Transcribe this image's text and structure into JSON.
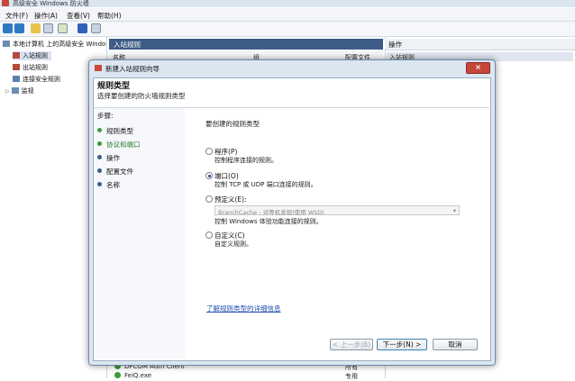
{
  "window": {
    "title": "高级安全 Windows 防火墙"
  },
  "menu": [
    "文件(F)",
    "操作(A)",
    "查看(V)",
    "帮助(H)"
  ],
  "tree": {
    "root": "本地计算机 上的高级安全 Windo",
    "items": [
      "入站规则",
      "出站规则",
      "连接安全规则",
      "监视"
    ]
  },
  "middle": {
    "header": "入站规则",
    "columns": [
      "名称",
      "组",
      "配置文件"
    ],
    "rows": [
      {
        "name": "DFCOM Auth Client",
        "profile": "所有"
      },
      {
        "name": "FeiQ.exe",
        "profile": "专用"
      }
    ]
  },
  "right": {
    "header": "操作",
    "sub": "入站规则"
  },
  "dialog": {
    "title": "新建入站规则向导",
    "step_title": "规则类型",
    "step_desc": "选择要创建的防火墙规则类型",
    "steps_label": "步骤:",
    "steps": [
      "规则类型",
      "协议和端口",
      "操作",
      "配置文件",
      "名称"
    ],
    "question": "要创建的规则类型",
    "options": [
      {
        "title": "程序(P)",
        "desc": "控制程序连接的规则。"
      },
      {
        "title": "端口(O)",
        "desc": "控制 TCP 或 UDP 端口连接的规则。"
      },
      {
        "title": "预定义(E):",
        "desc": "控制 Windows 体验功能连接的规则。"
      },
      {
        "title": "自定义(C)",
        "desc": "自定义规则。"
      }
    ],
    "predefined_value": "BranchCache - 对等机发现(使用 WSD)",
    "selected_option": "端口(O)",
    "learn_more": "了解规则类型的详细信息",
    "buttons": {
      "back": "< 上一步(B)",
      "next": "下一步(N) >",
      "cancel": "取消"
    }
  },
  "colors": {
    "accent": "#3d5d86",
    "step_active": "#3a9b3a",
    "step_pending": "#3d5d86"
  }
}
